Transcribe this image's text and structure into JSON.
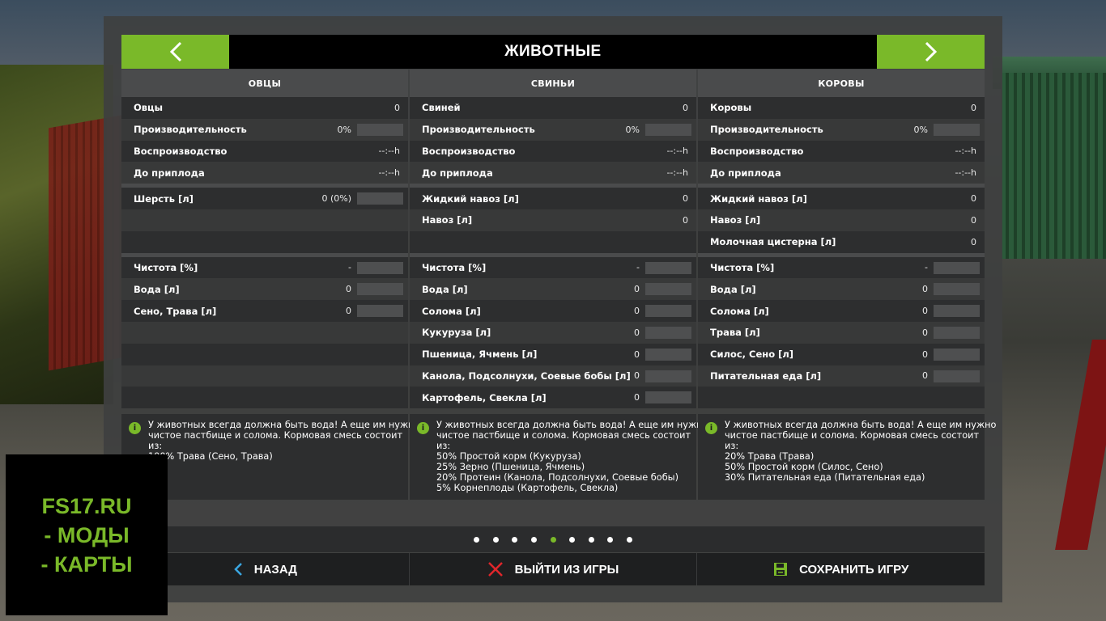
{
  "header": {
    "title": "ЖИВОТНЫЕ",
    "prev_icon": "chevron-left-icon",
    "next_icon": "chevron-right-icon",
    "accent_color": "#7ab929"
  },
  "columns": [
    {
      "title": "ОВЦЫ",
      "group1": [
        {
          "label": "Овцы",
          "value": "0",
          "bar": false
        },
        {
          "label": "Производительность",
          "value": "0%",
          "bar": true
        },
        {
          "label": "Воспроизводство",
          "value": "--:--h",
          "bar": false
        },
        {
          "label": "До приплода",
          "value": "--:--h",
          "bar": false
        }
      ],
      "group2": [
        {
          "label": "Шерсть [л]",
          "value": "0 (0%)",
          "bar": true
        },
        {
          "label": "",
          "value": "",
          "bar": false
        },
        {
          "label": "",
          "value": "",
          "bar": false
        }
      ],
      "group3": [
        {
          "label": "Чистота [%]",
          "value": "-",
          "bar": true
        },
        {
          "label": "Вода [л]",
          "value": "0",
          "bar": true
        },
        {
          "label": "Сено, Трава [л]",
          "value": "0",
          "bar": true
        },
        {
          "label": "",
          "value": "",
          "bar": false
        },
        {
          "label": "",
          "value": "",
          "bar": false
        },
        {
          "label": "",
          "value": "",
          "bar": false
        },
        {
          "label": "",
          "value": "",
          "bar": false
        }
      ],
      "info": [
        "У животных всегда должна быть вода! А еще им нужно",
        "чистое пастбище и солома. Кормовая смесь состоит",
        "из:",
        "100% Трава (Сено, Трава)"
      ]
    },
    {
      "title": "СВИНЬИ",
      "group1": [
        {
          "label": "Свиней",
          "value": "0",
          "bar": false
        },
        {
          "label": "Производительность",
          "value": "0%",
          "bar": true
        },
        {
          "label": "Воспроизводство",
          "value": "--:--h",
          "bar": false
        },
        {
          "label": "До приплода",
          "value": "--:--h",
          "bar": false
        }
      ],
      "group2": [
        {
          "label": "Жидкий навоз [л]",
          "value": "0",
          "bar": false
        },
        {
          "label": "Навоз [л]",
          "value": "0",
          "bar": false
        },
        {
          "label": "",
          "value": "",
          "bar": false
        }
      ],
      "group3": [
        {
          "label": "Чистота [%]",
          "value": "-",
          "bar": true
        },
        {
          "label": "Вода [л]",
          "value": "0",
          "bar": true
        },
        {
          "label": "Солома [л]",
          "value": "0",
          "bar": true
        },
        {
          "label": "Кукуруза [л]",
          "value": "0",
          "bar": true
        },
        {
          "label": "Пшеница, Ячмень [л]",
          "value": "0",
          "bar": true
        },
        {
          "label": "Канола, Подсолнухи, Соевые бобы [л]",
          "value": "0",
          "bar": true
        },
        {
          "label": "Картофель, Свекла [л]",
          "value": "0",
          "bar": true
        }
      ],
      "info": [
        "У животных всегда должна быть вода! А еще им нужно",
        "чистое пастбище и солома. Кормовая смесь состоит",
        "из:",
        "50% Простой корм (Кукуруза)",
        "25% Зерно (Пшеница, Ячмень)",
        "20% Протеин (Канола, Подсолнухи, Соевые бобы)",
        "5% Корнеплоды (Картофель, Свекла)"
      ]
    },
    {
      "title": "КОРОВЫ",
      "group1": [
        {
          "label": "Коровы",
          "value": "0",
          "bar": false
        },
        {
          "label": "Производительность",
          "value": "0%",
          "bar": true
        },
        {
          "label": "Воспроизводство",
          "value": "--:--h",
          "bar": false
        },
        {
          "label": "До приплода",
          "value": "--:--h",
          "bar": false
        }
      ],
      "group2": [
        {
          "label": "Жидкий навоз [л]",
          "value": "0",
          "bar": false
        },
        {
          "label": "Навоз [л]",
          "value": "0",
          "bar": false
        },
        {
          "label": "Молочная цистерна [л]",
          "value": "0",
          "bar": false
        }
      ],
      "group3": [
        {
          "label": "Чистота [%]",
          "value": "-",
          "bar": true
        },
        {
          "label": "Вода [л]",
          "value": "0",
          "bar": true
        },
        {
          "label": "Солома [л]",
          "value": "0",
          "bar": true
        },
        {
          "label": "Трава [л]",
          "value": "0",
          "bar": true
        },
        {
          "label": "Силос, Сено [л]",
          "value": "0",
          "bar": true
        },
        {
          "label": "Питательная еда [л]",
          "value": "0",
          "bar": true
        },
        {
          "label": "",
          "value": "",
          "bar": false
        }
      ],
      "info": [
        "У животных всегда должна быть вода! А еще им нужно",
        "чистое пастбище и солома. Кормовая смесь состоит",
        "из:",
        "20% Трава (Трава)",
        "50% Простой корм (Силос, Сено)",
        "30% Питательная еда (Питательная еда)"
      ]
    }
  ],
  "pagination": {
    "count": 9,
    "active_index": 4
  },
  "footer": {
    "back_label": "НАЗАД",
    "back_icon": "chevron-left-icon",
    "quit_label": "ВЫЙТИ ИЗ ИГРЫ",
    "quit_icon": "close-icon",
    "save_label": "СОХРАНИТЬ ИГРУ",
    "save_icon": "save-icon"
  },
  "watermark": {
    "line1": "FS17.RU",
    "line2": "- МОДЫ",
    "line3": "- КАРТЫ"
  }
}
